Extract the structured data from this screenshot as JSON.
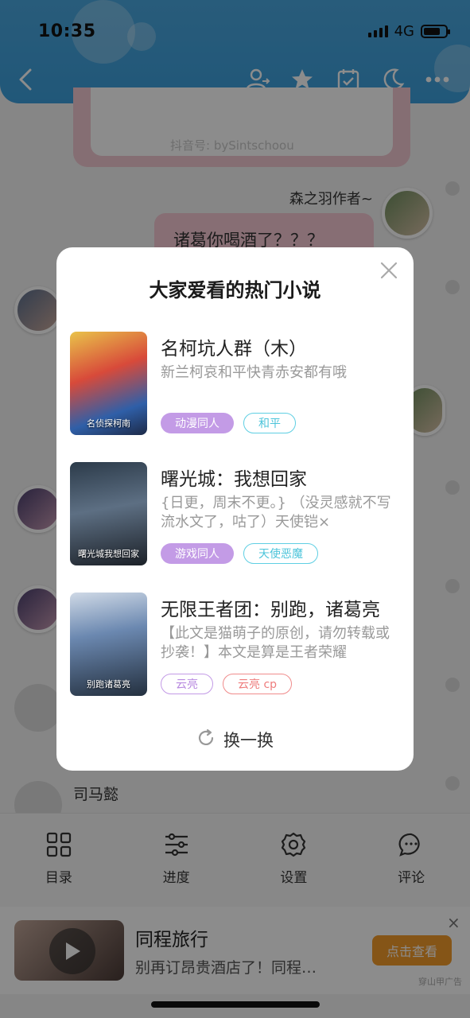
{
  "status_bar": {
    "time": "10:35",
    "network": "4G"
  },
  "chat": {
    "watermark": "抖音号: bySintschoou",
    "author_name": "森之羽作者~",
    "message": "诸葛你喝酒了？？？",
    "character_name": "司马懿"
  },
  "toolbar": [
    {
      "label": "目录",
      "icon": "grid-icon"
    },
    {
      "label": "进度",
      "icon": "sliders-icon"
    },
    {
      "label": "设置",
      "icon": "gear-icon"
    },
    {
      "label": "评论",
      "icon": "comment-icon"
    }
  ],
  "ad": {
    "title": "同程旅行",
    "description": "别再订昂贵酒店了！同程…",
    "button": "点击查看",
    "tag": "穿山甲广告",
    "close": "×"
  },
  "modal": {
    "title": "大家爱看的热门小说",
    "close": "×",
    "swap_label": "换一换",
    "novels": [
      {
        "title": "名柯坑人群（木）",
        "description": "新兰柯哀和平快青赤安都有哦",
        "cover_text": "名侦探柯南",
        "tags": [
          {
            "label": "动漫同人",
            "style": "filled"
          },
          {
            "label": "和平",
            "style": "outline-cyan"
          }
        ]
      },
      {
        "title": "曙光城：我想回家",
        "description": "{日更，周末不更。} （没灵感就不写流水文了，咕了）天使铠×",
        "cover_text": "曙光城我想回家",
        "tags": [
          {
            "label": "游戏同人",
            "style": "filled"
          },
          {
            "label": "天使恶魔",
            "style": "outline-cyan"
          }
        ]
      },
      {
        "title": "无限王者团：别跑，诸葛亮",
        "description": "【此文是猫萌子的原创，请勿转载或抄袭！】本文是算是王者荣耀",
        "cover_text": "别跑诸葛亮",
        "tags": [
          {
            "label": "云亮",
            "style": "outline-purple"
          },
          {
            "label": "云亮 cp",
            "style": "outline-red"
          }
        ]
      }
    ]
  },
  "colors": {
    "header_blue": "#3ea2de",
    "tag_purple": "#c39be6",
    "tag_cyan": "#5fcfe3",
    "tag_red": "#f08c8c",
    "ad_orange": "#f39b2a"
  }
}
